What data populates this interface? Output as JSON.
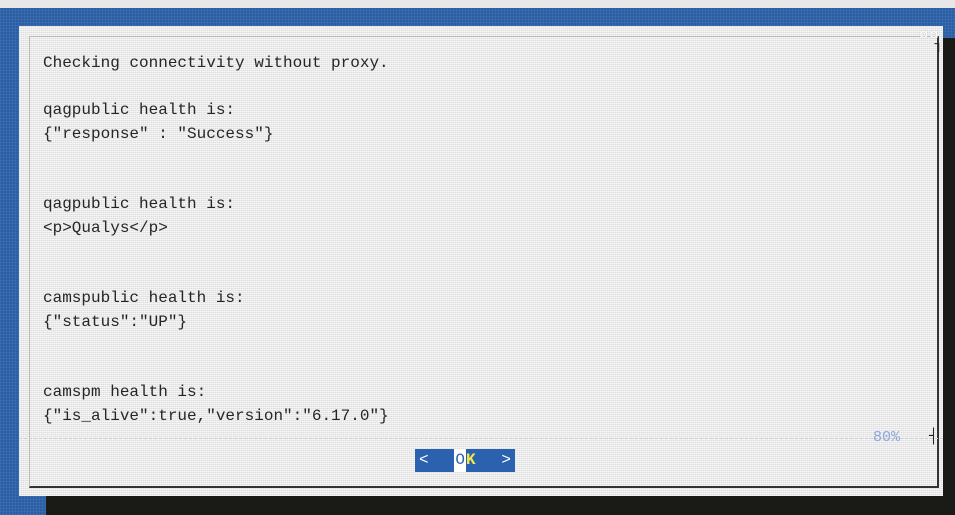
{
  "dialog": {
    "lines": [
      "Checking connectivity without proxy.",
      "qagpublic health is:",
      "{\"response\" : \"Success\"}",
      "qagpublic health is:",
      "<p>Qualys</p>",
      "camspublic health is:",
      "{\"status\":\"UP\"}",
      "camspm health is:",
      "{\"is_alive\":true,\"version\":\"6.17.0\"}"
    ],
    "progress": "80%",
    "corner_glyph": "¤¤"
  },
  "buttons": {
    "ok_left_bracket": "<",
    "ok_first_letter": "O",
    "ok_rest": "K",
    "ok_right_bracket": ">"
  },
  "colors": {
    "screen_background": "#2a5fa6",
    "dialog_background": "#eaeaea",
    "button_background": "#2a62b0",
    "button_hotkey": "#f6e84a",
    "progress_text": "#8ea6dd"
  },
  "icons": {
    "corner": "corner-glyph-icon"
  }
}
